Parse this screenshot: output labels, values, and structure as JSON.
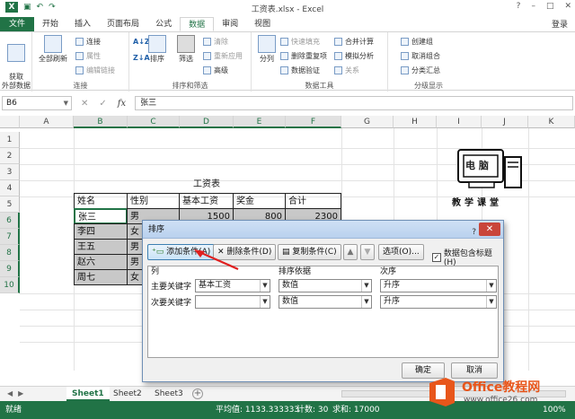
{
  "window": {
    "title": "工资表.xlsx - Excel",
    "controls": [
      "?",
      "–",
      "□",
      "✕"
    ]
  },
  "tabs": [
    "文件",
    "开始",
    "插入",
    "页面布局",
    "公式",
    "数据",
    "审阅",
    "视图"
  ],
  "active_tab": "数据",
  "login": "登录",
  "ribbon": {
    "get_external": "获取\n外部数据",
    "refresh_all": "全部刷新",
    "connections": "连接",
    "properties": "属性",
    "edit_links": "编辑链接",
    "group_connections": "连接",
    "sort_az": "A↓Z",
    "sort_za": "Z↓A",
    "sort": "排序",
    "filter": "筛选",
    "clear": "清除",
    "reapply": "重新应用",
    "advanced": "高级",
    "group_sort_filter": "排序和筛选",
    "text_to_columns": "分列",
    "flash_fill": "快速填充",
    "remove_duplicates": "删除重复项",
    "data_validation": "数据验证",
    "consolidate": "合并计算",
    "what_if": "模拟分析",
    "relationships": "关系",
    "group_data_tools": "数据工具",
    "group": "创建组",
    "ungroup": "取消组合",
    "subtotal": "分类汇总",
    "group_outline": "分级显示"
  },
  "formula_bar": {
    "name_box": "B6",
    "formula": "张三",
    "fx": "fx",
    "cancel": "✕",
    "enter": "✓"
  },
  "columns": [
    "A",
    "B",
    "C",
    "D",
    "E",
    "F",
    "G",
    "H",
    "I",
    "J",
    "K"
  ],
  "rows": [
    "1",
    "2",
    "3",
    "4",
    "5",
    "6",
    "7",
    "8",
    "9",
    "10"
  ],
  "sheet": {
    "table_title": "工资表",
    "headers": [
      "姓名",
      "性别",
      "基本工资",
      "奖金",
      "合计"
    ],
    "names": [
      "张三",
      "李四",
      "王五",
      "赵六",
      "周七"
    ],
    "genders": [
      "男",
      "女",
      "男",
      "男",
      "女"
    ],
    "row6_values": [
      "1500",
      "800",
      "2300"
    ]
  },
  "logo_text": {
    "top": "电 脑",
    "bottom": "教学课堂"
  },
  "sheet_tabs": [
    "Sheet1",
    "Sheet2",
    "Sheet3"
  ],
  "active_sheet": "Sheet1",
  "status": {
    "ready": "就绪",
    "average": "平均值: 1133.333333",
    "count": "计数: 30",
    "sum": "求和: 17000",
    "zoom": "100%"
  },
  "dialog": {
    "title": "排序",
    "help": "?",
    "close": "✕",
    "add_level": "添加条件(A)",
    "delete_level": "删除条件(D)",
    "copy_level": "复制条件(C)",
    "move_up": "▲",
    "move_down": "▼",
    "options": "选项(O)...",
    "has_headers": "数据包含标题(H)",
    "col_header": "列",
    "sort_on_header": "排序依据",
    "order_header": "次序",
    "rows": [
      {
        "label": "主要关键字",
        "column": "基本工资",
        "sort_on": "数值",
        "order": "升序"
      },
      {
        "label": "次要关键字",
        "column": "",
        "sort_on": "数值",
        "order": "升序"
      }
    ],
    "ok": "确定",
    "cancel": "取消"
  },
  "brand": {
    "name": "Office教程网",
    "url": "www.office26.com"
  }
}
